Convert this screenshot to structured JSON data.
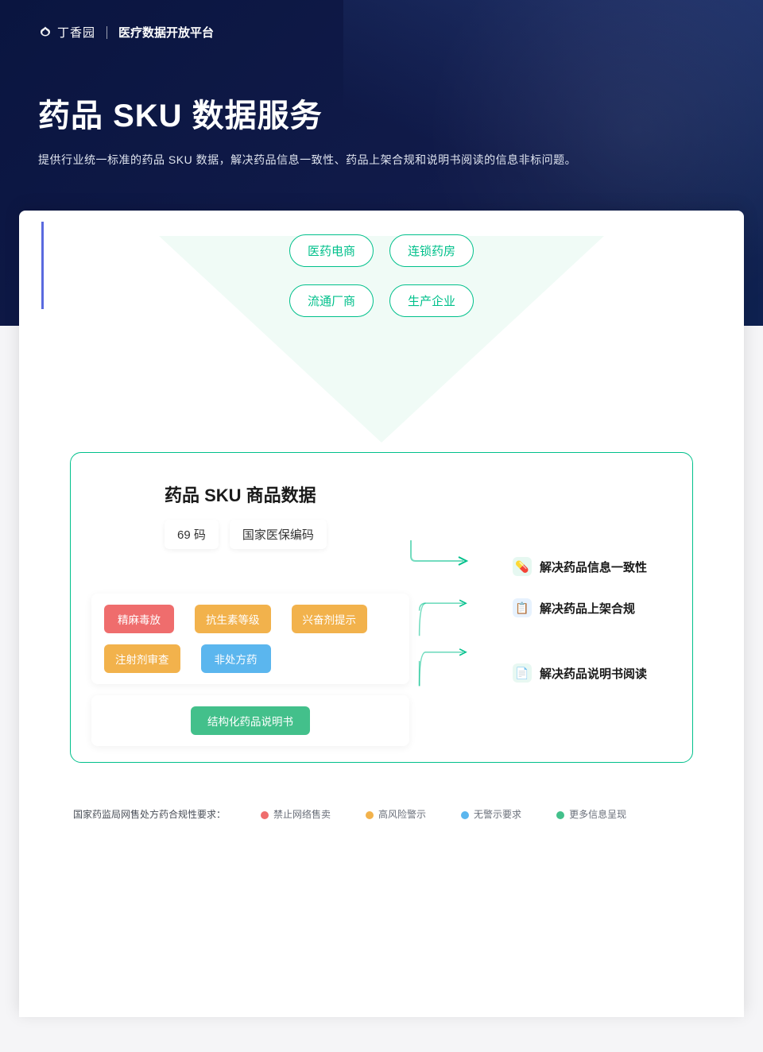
{
  "brand": {
    "name": "丁香园",
    "platform": "医疗数据开放平台"
  },
  "hero": {
    "title": "药品 SKU 数据服务",
    "subtitle": "提供行业统一标准的药品 SKU 数据，解决药品信息一致性、药品上架合规和说明书阅读的信息非标问题。"
  },
  "sources": {
    "row1": [
      "医药电商",
      "连锁药房"
    ],
    "row2": [
      "流通厂商",
      "生产企业"
    ]
  },
  "skuBox": {
    "title": "药品 SKU 商品数据",
    "codes": [
      "69 码",
      "国家医保编码"
    ],
    "complianceTags": [
      {
        "label": "精麻毒放",
        "color": "t-red"
      },
      {
        "label": "抗生素等级",
        "color": "t-orange"
      },
      {
        "label": "兴奋剂提示",
        "color": "t-orange"
      },
      {
        "label": "注射剂审查",
        "color": "t-orange"
      },
      {
        "label": "非处方药",
        "color": "t-blue"
      }
    ],
    "manualTag": {
      "label": "结构化药品说明书",
      "color": "t-green"
    },
    "results": [
      {
        "icon": "💊",
        "cls": "ric1",
        "label": "解决药品信息一致性"
      },
      {
        "icon": "📋",
        "cls": "ric2",
        "label": "解决药品上架合规"
      },
      {
        "icon": "📄",
        "cls": "ric3",
        "label": "解决药品说明书阅读"
      }
    ]
  },
  "legend": {
    "title": "国家药监局网售处方药合规性要求：",
    "items": [
      {
        "dot": "d-red",
        "label": "禁止网络售卖"
      },
      {
        "dot": "d-orange",
        "label": "高风险警示"
      },
      {
        "dot": "d-blue",
        "label": "无警示要求"
      },
      {
        "dot": "d-green",
        "label": "更多信息呈现"
      }
    ]
  }
}
